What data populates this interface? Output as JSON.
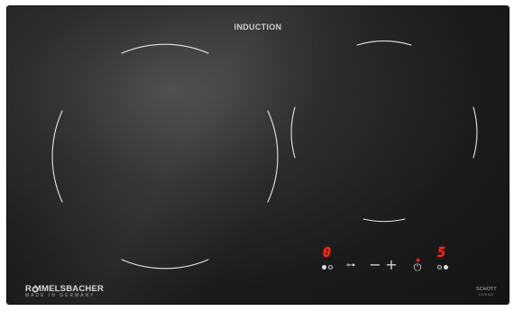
{
  "appliance": {
    "title": "INDUCTION",
    "brand": "R MMELSBACHER",
    "brand_sub": "MADE IN GERMANY",
    "glass_brand": "SCHOTT",
    "glass_sub": "CERAN"
  },
  "controls": {
    "left_zone_level": "0",
    "right_zone_level": "5",
    "minus_symbol": "−",
    "plus_symbol": "+",
    "key_symbol": "⊶",
    "power_symbol": "⏻"
  },
  "colors": {
    "display_red": "#ff2a1f",
    "glass": "#1b1b1b",
    "zone_lines": "#e6e6e6"
  }
}
